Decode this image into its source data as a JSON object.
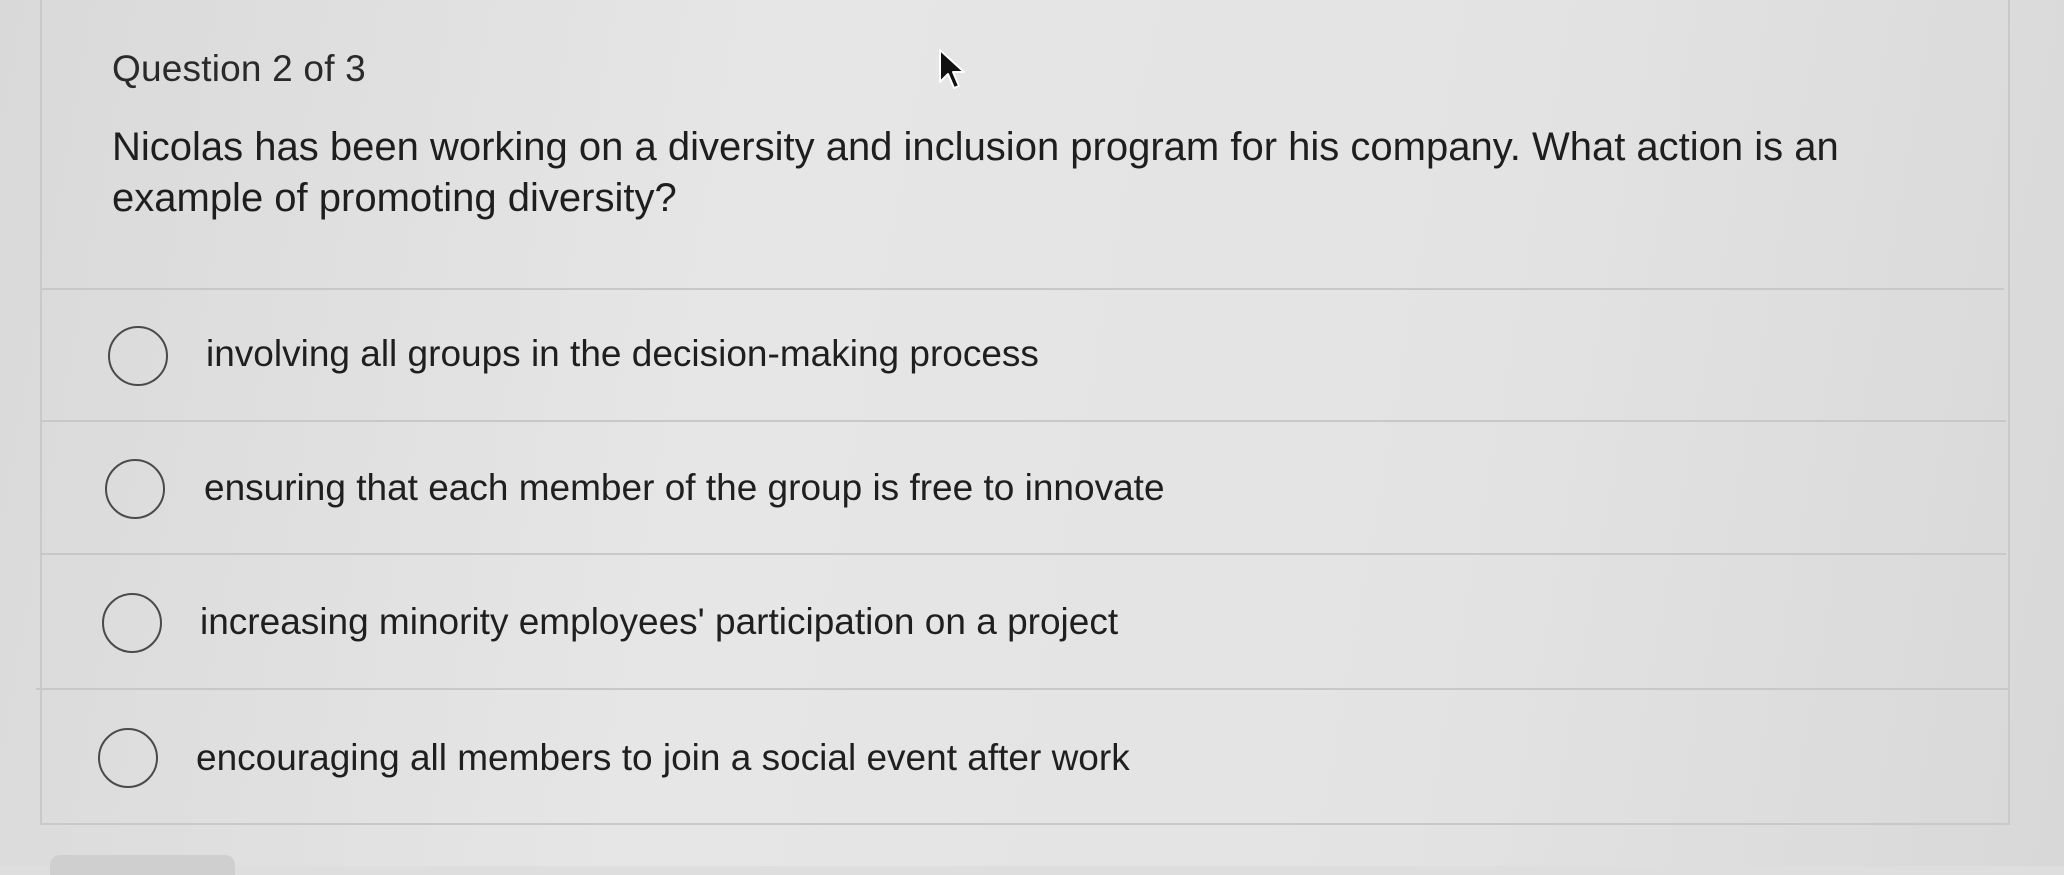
{
  "quiz": {
    "counter": "Question 2 of 3",
    "prompt": "Nicolas has been working on a diversity and inclusion program for his company. What action is an example of promoting diversity?",
    "options": [
      {
        "label": "involving all groups in the decision-making process",
        "selected": false
      },
      {
        "label": "ensuring that each member of the group is free to innovate",
        "selected": false
      },
      {
        "label": "increasing minority employees' participation on a project",
        "selected": false
      },
      {
        "label": "encouraging all members to join a social event after work",
        "selected": false
      }
    ]
  },
  "icons": {
    "cursor": "mouse-pointer-icon",
    "radio": "radio-button-unchecked-icon"
  }
}
